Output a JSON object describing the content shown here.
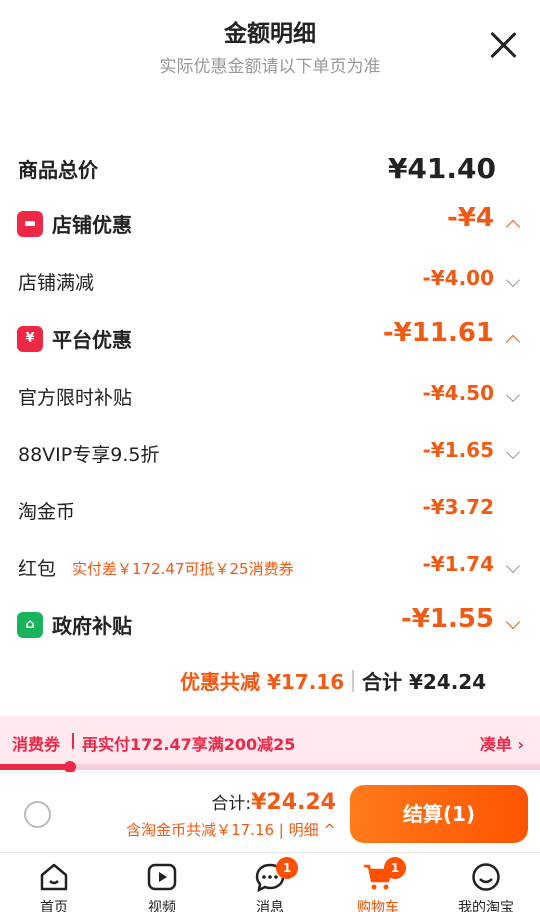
{
  "header": {
    "title": "金额明细",
    "subtitle": "实际优惠金额请以下单页为准"
  },
  "rows": {
    "total": {
      "label": "商品总价",
      "amount": "¥41.40"
    },
    "store": {
      "label": "店铺优惠",
      "amount": "-¥4",
      "icon": "store-icon"
    },
    "store_full": {
      "label": "店铺满减",
      "amount": "-¥4.00"
    },
    "platform": {
      "label": "平台优惠",
      "amount": "-¥11.61",
      "icon": "yuan-coupon-icon"
    },
    "official": {
      "label": "官方限时补贴",
      "amount": "-¥4.50"
    },
    "vip": {
      "label": "88VIP专享9.5折",
      "amount": "-¥1.65"
    },
    "coin": {
      "label": "淘金币",
      "amount": "-¥3.72"
    },
    "redpacket": {
      "label": "红包",
      "hint": "实付差￥172.47可抵￥25消费券",
      "amount": "-¥1.74"
    },
    "gov": {
      "label": "政府补贴",
      "amount": "-¥1.55",
      "icon": "house-icon"
    }
  },
  "summary": {
    "discount": "优惠共减 ¥17.16",
    "total": "合计 ¥24.24"
  },
  "coupon": {
    "title": "消费券",
    "text": "再实付172.47享满200减25",
    "link": "凑单 ›",
    "progress": 0.13
  },
  "checkout": {
    "total_label": "合计:",
    "total_value": "¥24.24",
    "discount_text": "含淘金币共减￥17.16 | 明细",
    "pay_button": "结算(1)"
  },
  "tabs": [
    {
      "label": "首页",
      "icon": "home-icon"
    },
    {
      "label": "视频",
      "icon": "video-icon"
    },
    {
      "label": "消息",
      "icon": "message-icon",
      "badge": "1"
    },
    {
      "label": "购物车",
      "icon": "cart-icon",
      "badge": "1",
      "active": true
    },
    {
      "label": "我的淘宝",
      "icon": "profile-icon"
    }
  ],
  "colors": {
    "accent": "#f05a14",
    "red": "#ee2746",
    "green": "#18b35a"
  }
}
